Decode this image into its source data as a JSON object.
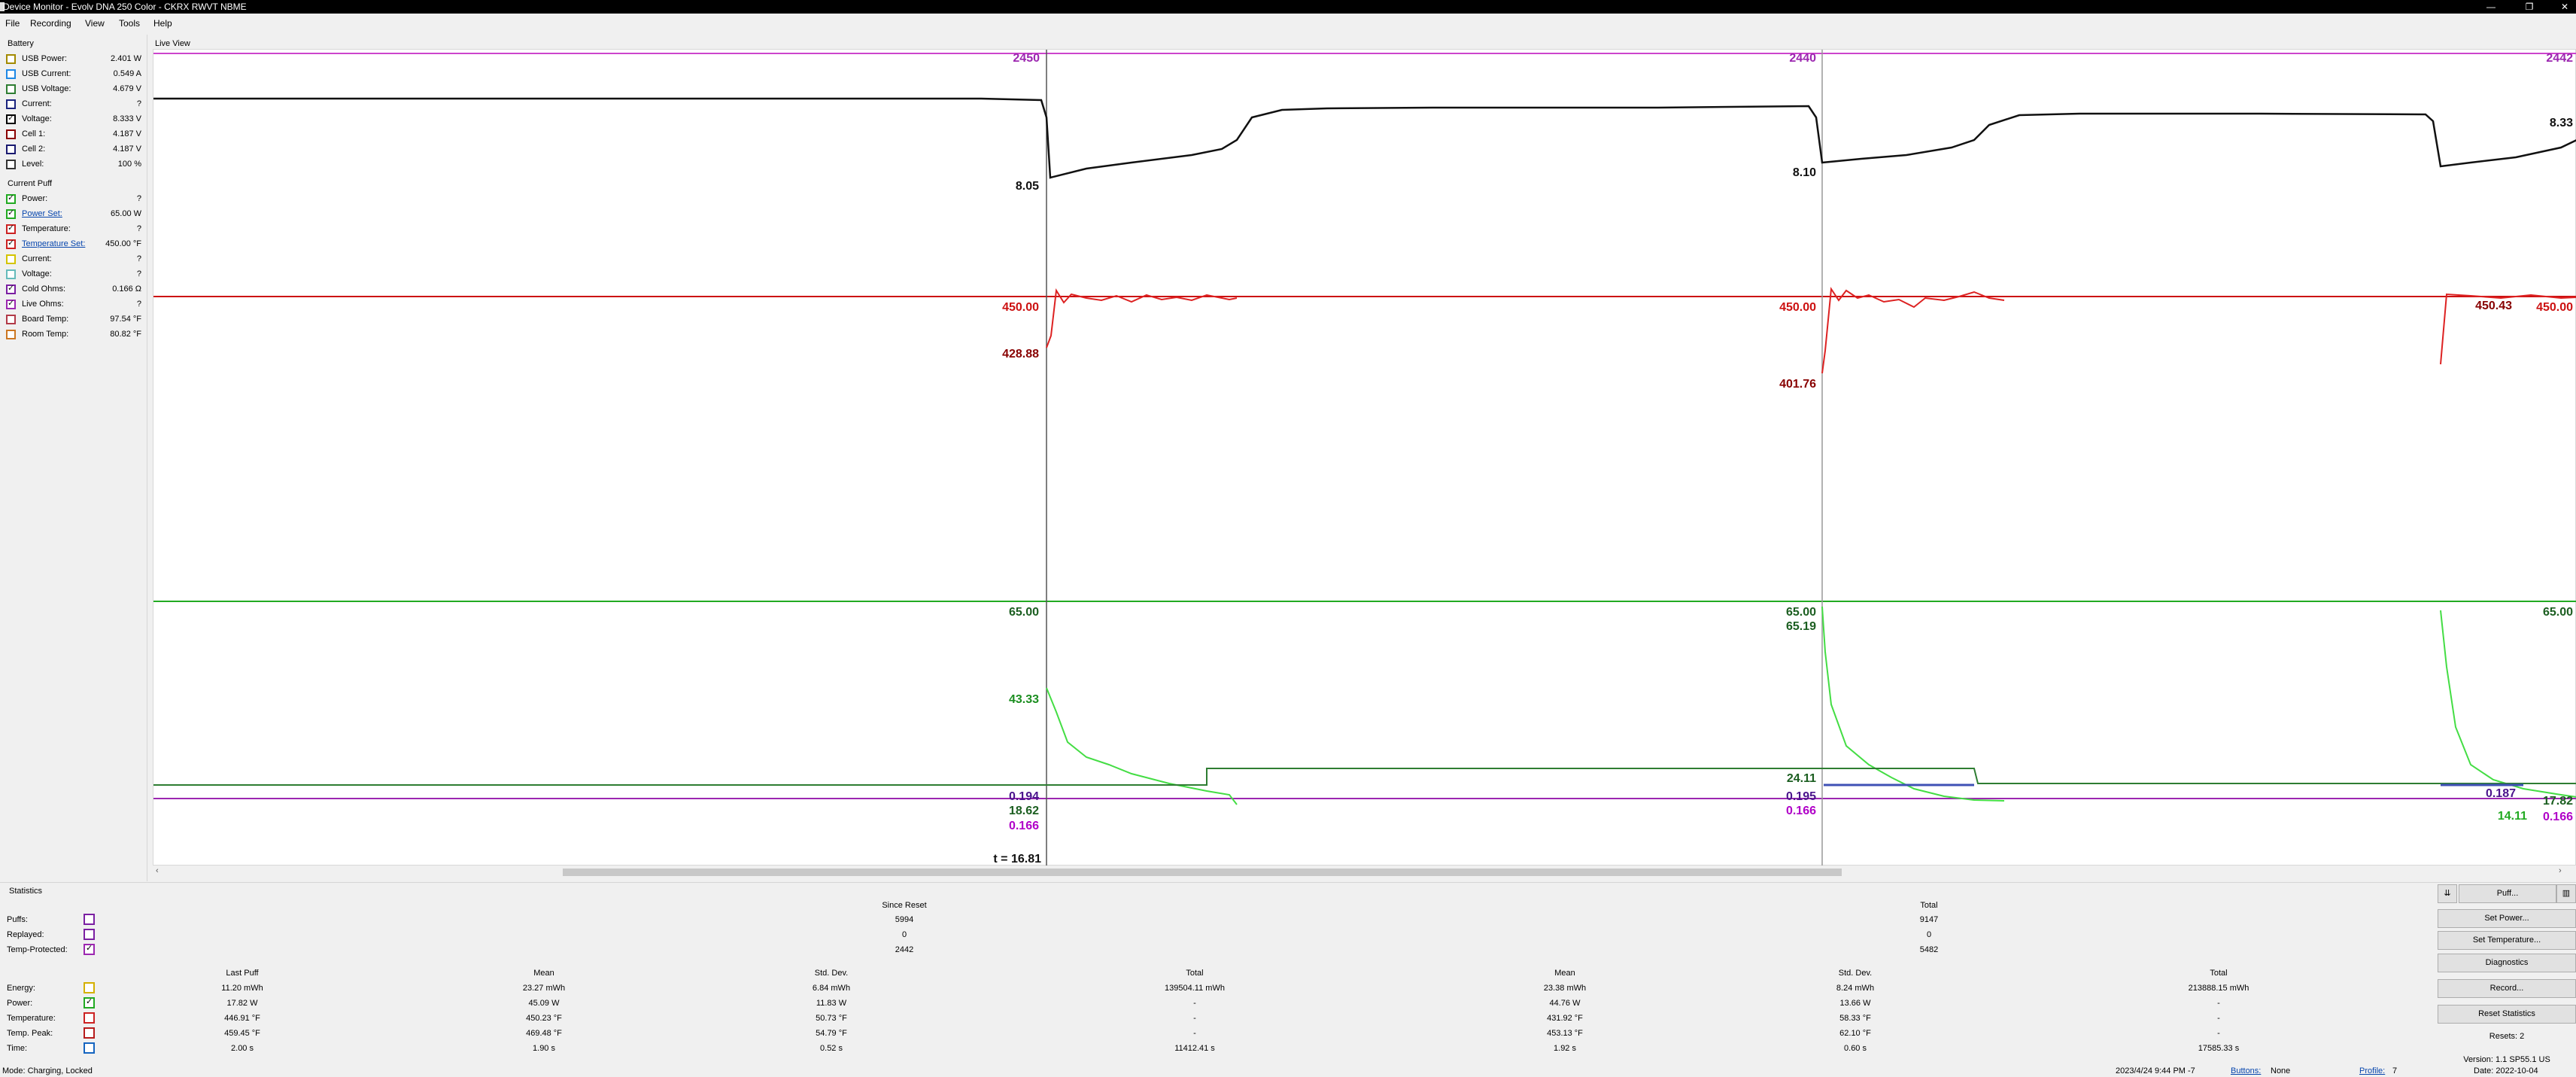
{
  "window": {
    "title": "Device Monitor - Evolv DNA 250 Color - CKRX RWVT NBME",
    "minimize": "—",
    "maximize": "❐",
    "close": "✕"
  },
  "menu": [
    "File",
    "Recording",
    "View",
    "Tools",
    "Help"
  ],
  "battery": {
    "title": "Battery",
    "rows": [
      {
        "label": "USB Power:",
        "value": "2.401 W",
        "color": "#a38a00",
        "checked": false
      },
      {
        "label": "USB Current:",
        "value": "0.549 A",
        "color": "#1e88e5",
        "checked": false
      },
      {
        "label": "USB Voltage:",
        "value": "4.679 V",
        "color": "#2e7d32",
        "checked": false
      },
      {
        "label": "Current:",
        "value": "?",
        "color": "#1a237e",
        "checked": false
      },
      {
        "label": "Voltage:",
        "value": "8.333 V",
        "color": "#000000",
        "checked": true
      },
      {
        "label": "Cell 1:",
        "value": "4.187 V",
        "color": "#8b0000",
        "checked": false
      },
      {
        "label": "Cell 2:",
        "value": "4.187 V",
        "color": "#191970",
        "checked": false
      },
      {
        "label": "Level:",
        "value": "100 %",
        "color": "#333333",
        "checked": false
      }
    ]
  },
  "current_puff": {
    "title": "Current Puff",
    "rows": [
      {
        "label": "Power:",
        "value": "?",
        "color": "#22aa22",
        "checked": true,
        "link": false
      },
      {
        "label": "Power Set:",
        "value": "65.00 W",
        "color": "#22aa22",
        "checked": true,
        "link": true
      },
      {
        "label": "Temperature:",
        "value": "?",
        "color": "#cc2222",
        "checked": true,
        "link": false
      },
      {
        "label": "Temperature Set:",
        "value": "450.00 °F",
        "color": "#cc2222",
        "checked": true,
        "link": true
      },
      {
        "label": "Current:",
        "value": "?",
        "color": "#d4c400",
        "checked": false,
        "link": false
      },
      {
        "label": "Voltage:",
        "value": "?",
        "color": "#66bbbb",
        "checked": false,
        "link": false
      },
      {
        "label": "Cold Ohms:",
        "value": "0.166 Ω",
        "color": "#7b1fa2",
        "checked": true,
        "link": false
      },
      {
        "label": "Live Ohms:",
        "value": "?",
        "color": "#9c27b0",
        "checked": true,
        "link": false
      },
      {
        "label": "Board Temp:",
        "value": "97.54 °F",
        "color": "#b23a48",
        "checked": false,
        "link": false
      },
      {
        "label": "Room Temp:",
        "value": "80.82 °F",
        "color": "#cc7722",
        "checked": false,
        "link": false
      }
    ]
  },
  "live_view": {
    "title": "Live View",
    "labels": {
      "top_a": "2450",
      "top_b": "2440",
      "top_c": "2442",
      "v1": "8.05",
      "v2": "8.10",
      "v3": "8.33",
      "temp_set_1": "450.00",
      "temp_set_2": "450.00",
      "temp_set_3": "450.00",
      "temp_a": "428.88",
      "temp_b": "401.76",
      "temp_c": "450.43",
      "power_set_1": "65.00",
      "power_set_2": "65.00",
      "power_set_3": "65.00",
      "power_a": "43.33",
      "power_b": "65.19",
      "power_c": "24.11",
      "power_d": "18.62",
      "power_e": "14.11",
      "power_f": "17.82",
      "ohm_a": "0.166",
      "ohm_b": "0.166",
      "ohm_c": "0.166",
      "ohm_live_a": "0.194",
      "ohm_live_b": "0.195",
      "ohm_live_c": "0.187",
      "time": "t = 16.81"
    }
  },
  "statistics": {
    "title": "Statistics",
    "since_reset": "Since Reset",
    "total": "Total",
    "counters": [
      {
        "label": "Puffs:",
        "since": "5994",
        "total": "9147",
        "color": "#7b1fa2",
        "checked": false
      },
      {
        "label": "Replayed:",
        "since": "0",
        "total": "0",
        "color": "#7b1fa2",
        "checked": false
      },
      {
        "label": "Temp-Protected:",
        "since": "2442",
        "total": "5482",
        "color": "#9c27b0",
        "checked": true
      }
    ],
    "headers": [
      "Last Puff",
      "Mean",
      "Std. Dev.",
      "Total",
      "Mean",
      "Std. Dev.",
      "Total"
    ],
    "rows": [
      {
        "label": "Energy:",
        "color": "#d4b000",
        "checked": false,
        "cells": [
          "11.20 mWh",
          "23.27 mWh",
          "6.84 mWh",
          "139504.11 mWh",
          "23.38 mWh",
          "8.24 mWh",
          "213888.15 mWh"
        ]
      },
      {
        "label": "Power:",
        "color": "#22aa22",
        "checked": true,
        "cells": [
          "17.82 W",
          "45.09 W",
          "11.83 W",
          "-",
          "44.76 W",
          "13.66 W",
          "-"
        ]
      },
      {
        "label": "Temperature:",
        "color": "#cc2222",
        "checked": false,
        "cells": [
          "446.91 °F",
          "450.23 °F",
          "50.73 °F",
          "-",
          "431.92 °F",
          "58.33 °F",
          "-"
        ]
      },
      {
        "label": "Temp. Peak:",
        "color": "#b71c1c",
        "checked": false,
        "cells": [
          "459.45 °F",
          "469.48 °F",
          "54.79 °F",
          "-",
          "453.13 °F",
          "62.10 °F",
          "-"
        ]
      },
      {
        "label": "Time:",
        "color": "#1565c0",
        "checked": false,
        "cells": [
          "2.00 s",
          "1.90 s",
          "0.52 s",
          "11412.41 s",
          "1.92 s",
          "0.60 s",
          "17585.33 s"
        ]
      }
    ]
  },
  "buttons": {
    "puff": "Puff...",
    "set_power": "Set Power...",
    "set_temperature": "Set Temperature...",
    "diagnostics": "Diagnostics",
    "record": "Record...",
    "reset_statistics": "Reset Statistics",
    "resets": "Resets: 2",
    "version": "Version: 1.1 SP55.1 US",
    "date": "Date: 2022-10-04"
  },
  "status": {
    "mode": "Mode: Charging, Locked",
    "datetime": "2023/4/24 9:44 PM -7",
    "buttons_label": "Buttons:",
    "buttons_value": "None",
    "profile_label": "Profile:",
    "profile_value": "7"
  }
}
